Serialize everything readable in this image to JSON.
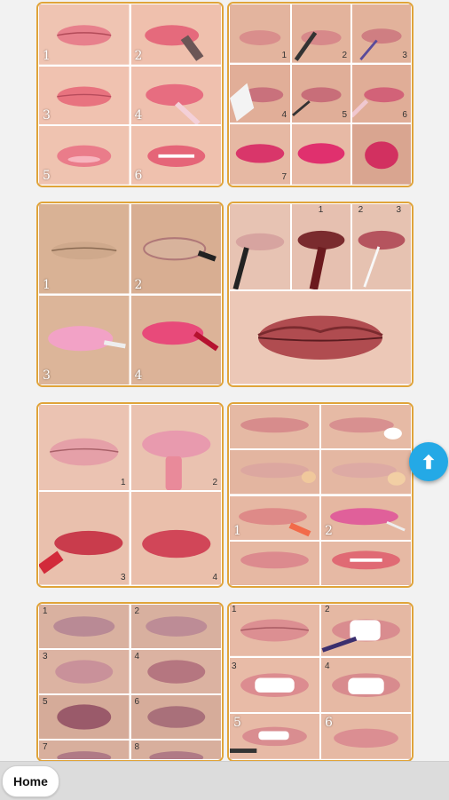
{
  "bottom_nav": {
    "home_label": "Home"
  },
  "scroll_top": {
    "icon": "arrow-up-icon",
    "color": "#24a9e6"
  },
  "colors": {
    "card_border": "#e0a43a",
    "skin": "#e9b8a4",
    "lip_pink": "#e8737f"
  },
  "gallery": [
    {
      "name": "gallery-image-1",
      "labels": [
        "1",
        "2",
        "3",
        "4",
        "5",
        "6"
      ]
    },
    {
      "name": "gallery-image-2",
      "labels": [
        "1",
        "2",
        "3",
        "4",
        "5",
        "6",
        "7"
      ]
    },
    {
      "name": "gallery-image-3",
      "labels": [
        "1",
        "2",
        "3",
        "4"
      ]
    },
    {
      "name": "gallery-image-4",
      "labels": [
        "1",
        "2",
        "3"
      ]
    },
    {
      "name": "gallery-image-5",
      "labels": [
        "1",
        "2",
        "3",
        "4"
      ]
    },
    {
      "name": "gallery-image-6",
      "labels": [
        "1",
        "2"
      ]
    },
    {
      "name": "gallery-image-7",
      "labels": [
        "1",
        "2",
        "3",
        "4",
        "5",
        "6",
        "7",
        "8"
      ]
    },
    {
      "name": "gallery-image-8",
      "labels": [
        "1",
        "2",
        "3",
        "4",
        "5",
        "6"
      ]
    }
  ]
}
